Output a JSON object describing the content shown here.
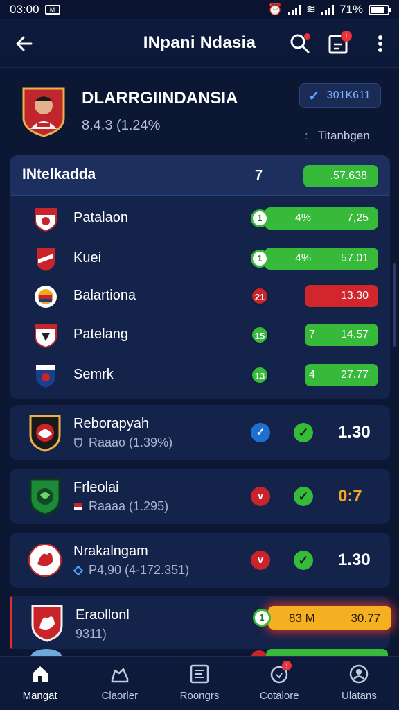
{
  "status_bar": {
    "time": "03:00",
    "battery": "71%"
  },
  "app_bar": {
    "title": "INpani Ndasia"
  },
  "profile": {
    "name": "DLARRGIINDANSIA",
    "subtitle": "8.4.3 (1.24%",
    "verify_label": "301K611",
    "tag": "Titanbgen"
  },
  "group": {
    "title": "INtelkadda",
    "count": "7",
    "total": ".57.638",
    "rows": [
      {
        "name": "Patalaon",
        "badge": "1",
        "pct": "4%",
        "value": "7,25"
      },
      {
        "name": "Kuei",
        "badge": "1",
        "pct": "4%",
        "value": "57.01"
      },
      {
        "name": "Balartiona",
        "badge": "21",
        "pct": "",
        "value": "13.30"
      },
      {
        "name": "Patelang",
        "badge": "15",
        "pct": "7",
        "value": "14.57"
      },
      {
        "name": "Semrk",
        "badge": "13",
        "pct": "4",
        "value": "27.77"
      }
    ]
  },
  "teams": [
    {
      "name": "Reborapyah",
      "sub": "Raaao (1.39%)",
      "score": "1.30"
    },
    {
      "name": "Frleolai",
      "sub": "Raaaa (1.295)",
      "score": "0:7"
    },
    {
      "name": "Nrakalngam",
      "sub": "P4,90 (4-172.351)",
      "score": "1.30"
    }
  ],
  "featured": {
    "name": "Eraollonl",
    "sub": "9311)",
    "badge": "1",
    "pct": "83 M",
    "value": "30.77"
  },
  "bottom_nav": [
    {
      "label": "Mangat",
      "icon": "home-icon"
    },
    {
      "label": "Claorler",
      "icon": "shoe-icon"
    },
    {
      "label": "Roongrs",
      "icon": "scoreboard-icon"
    },
    {
      "label": "Cotalore",
      "icon": "notification-icon"
    },
    {
      "label": "Ulatans",
      "icon": "profile-icon"
    }
  ],
  "colors": {
    "background": "#0b1733",
    "card": "#13234a",
    "green": "#37b93a",
    "red": "#d0262c",
    "orange": "#f5a623"
  }
}
